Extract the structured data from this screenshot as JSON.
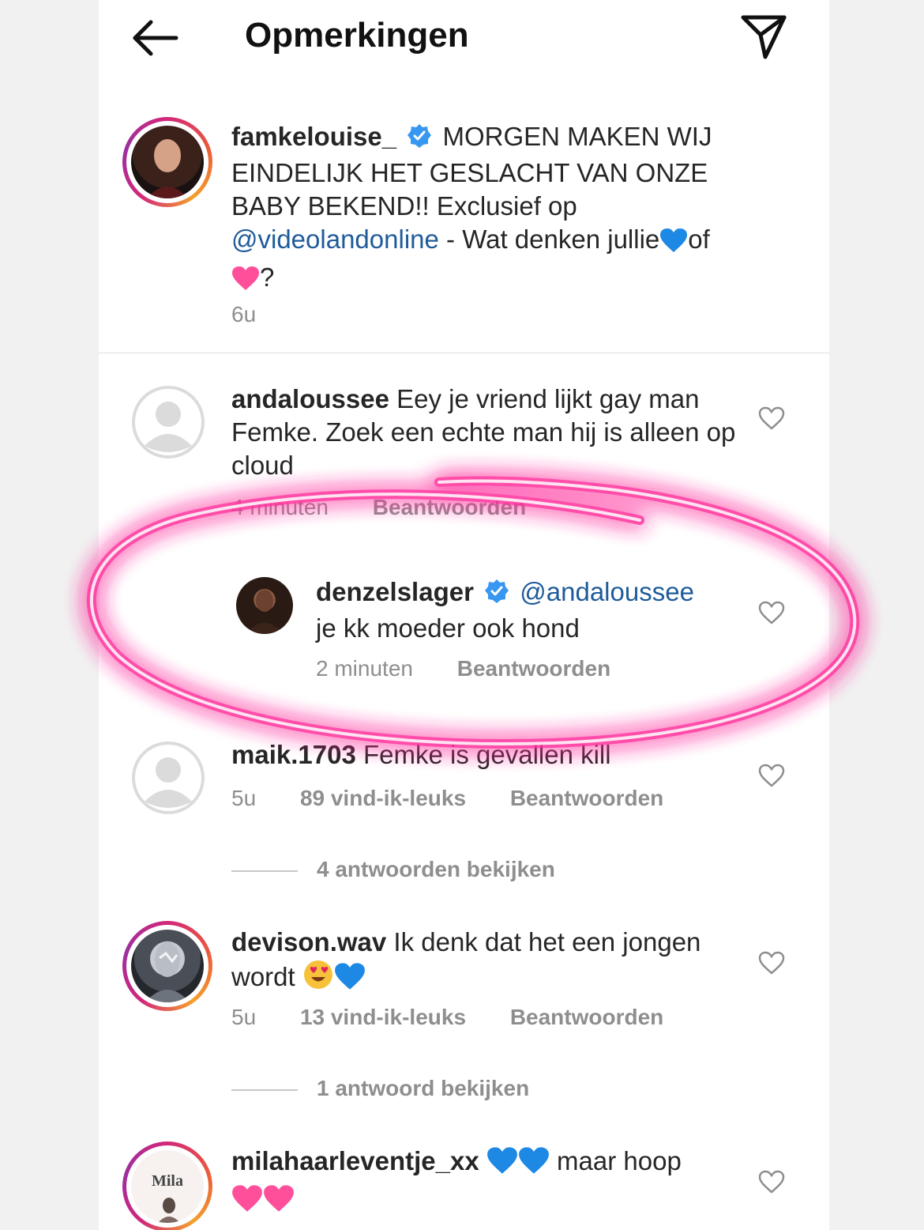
{
  "header": {
    "title": "Opmerkingen"
  },
  "caption": {
    "username": "famkelouise_",
    "text_1": "MORGEN MAKEN WIJ EINDELIJK HET GESLACHT VAN ONZE BABY BEKEND!! Exclusief op",
    "mention": "@videolandonline",
    "text_2": "- Wat denken jullie",
    "text_3": "of",
    "text_4": "?",
    "time": "6u"
  },
  "comments": [
    {
      "username": "andaloussee",
      "text": "Eey je vriend lijkt gay man Femke. Zoek een echte man hij is alleen op cloud",
      "time": "4 minuten",
      "reply_label": "Beantwoorden"
    },
    {
      "username": "denzelslager",
      "mention": "@andaloussee",
      "text": "je kk moeder ook hond",
      "time": "2 minuten",
      "reply_label": "Beantwoorden"
    },
    {
      "username": "maik.1703",
      "text": "Femke is gevallen kill",
      "time": "5u",
      "likes": "89 vind-ik-leuks",
      "reply_label": "Beantwoorden",
      "view_replies": "4 antwoorden bekijken"
    },
    {
      "username": "devison.wav",
      "text": "Ik denk dat het een jongen wordt",
      "time": "5u",
      "likes": "13 vind-ik-leuks",
      "reply_label": "Beantwoorden",
      "view_replies": "1 antwoord bekijken"
    },
    {
      "username": "milahaarleventje_xx",
      "text": "maar hoop",
      "avatar_text": "Mila"
    }
  ],
  "colors": {
    "highlight": "#ff3fa6",
    "verified": "#3897f0",
    "mention": "#1f5b9a",
    "blue_heart": "#1e88e5",
    "pink_heart": "#ff4f9a"
  }
}
